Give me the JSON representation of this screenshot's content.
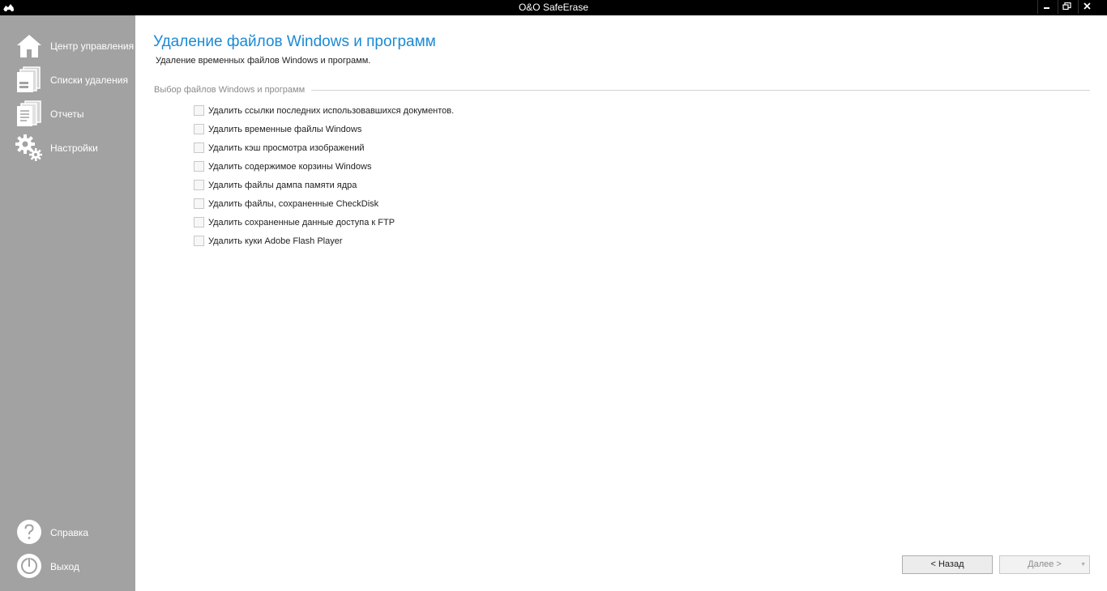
{
  "window": {
    "title": "O&O SafeErase",
    "app_icon": "safeerase-logo-icon",
    "controls": [
      "minimize-icon",
      "maximize-icon",
      "close-icon"
    ]
  },
  "sidebar": {
    "background": "#a2a2a2",
    "items": [
      {
        "label": "Центр управления",
        "icon": "home-icon"
      },
      {
        "label": "Списки удаления",
        "icon": "deletion-lists-icon"
      },
      {
        "label": "Отчеты",
        "icon": "reports-icon"
      },
      {
        "label": "Настройки",
        "icon": "gears-icon"
      }
    ],
    "bottom_items": [
      {
        "label": "Справка",
        "icon": "help-icon"
      },
      {
        "label": "Выход",
        "icon": "power-icon"
      }
    ]
  },
  "main": {
    "title": "Удаление файлов Windows и программ",
    "title_color": "#1a8ad4",
    "subtitle": "Удаление временных файлов Windows и программ.",
    "group_label": "Выбор файлов Windows и программ",
    "options": [
      {
        "label": "Удалить ссылки последних использовавшихся документов.",
        "checked": false
      },
      {
        "label": "Удалить временные файлы Windows",
        "checked": false
      },
      {
        "label": "Удалить кэш просмотра изображений",
        "checked": false
      },
      {
        "label": "Удалить содержимое корзины Windows",
        "checked": false
      },
      {
        "label": "Удалить файлы дампа памяти ядра",
        "checked": false
      },
      {
        "label": "Удалить файлы, сохраненные CheckDisk",
        "checked": false
      },
      {
        "label": "Удалить сохраненные данные доступа к FTP",
        "checked": false
      },
      {
        "label": "Удалить куки Adobe Flash Player",
        "checked": false
      }
    ]
  },
  "footer": {
    "back_label": "< Назад",
    "next_label": "Далее >",
    "next_enabled": false
  }
}
